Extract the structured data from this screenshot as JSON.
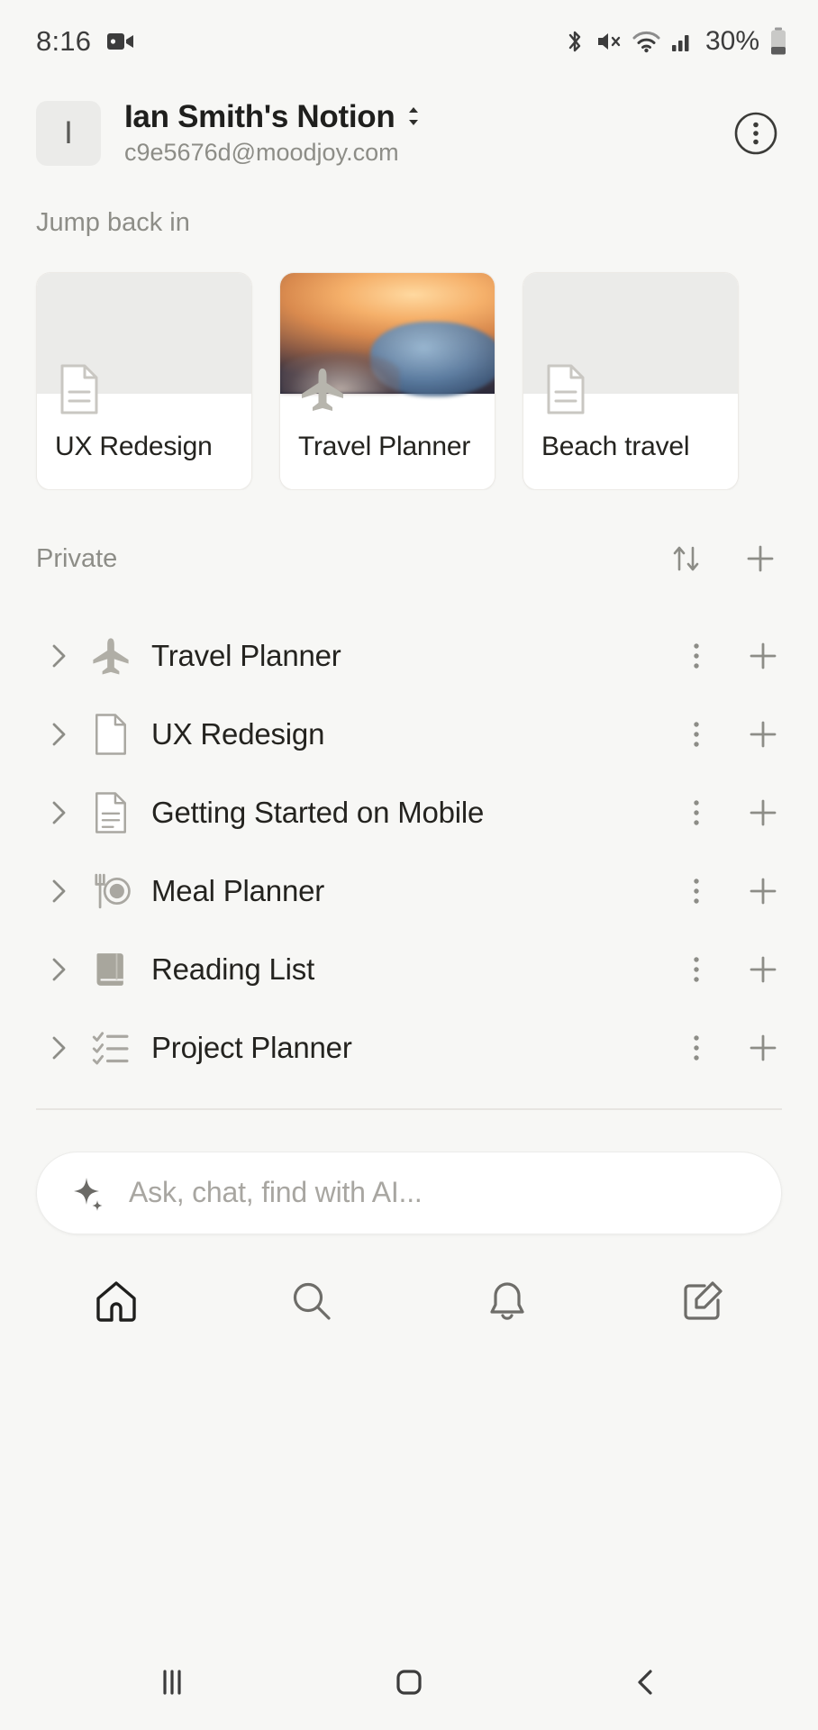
{
  "status_bar": {
    "time": "8:16",
    "battery_percent": "30%",
    "icons": [
      "video-record-icon",
      "bluetooth-icon",
      "mute-icon",
      "wifi-icon",
      "cellular-signal-icon",
      "battery-icon"
    ]
  },
  "workspace": {
    "avatar_letter": "I",
    "name": "Ian Smith's Notion",
    "email": "c9e5676d@moodjoy.com",
    "more_icon": "more-options-icon",
    "switch_icon": "chevron-up-down-icon"
  },
  "jump_back_in": {
    "title": "Jump back in",
    "cards": [
      {
        "title": "UX Redesign",
        "icon": "document-icon",
        "cover": "plain"
      },
      {
        "title": "Travel Planner",
        "icon": "airplane-icon",
        "cover": "sunset-photo"
      },
      {
        "title": "Beach travel",
        "icon": "document-icon",
        "cover": "plain"
      }
    ]
  },
  "private": {
    "title": "Private",
    "sort_icon": "sort-arrows-icon",
    "add_icon": "plus-icon",
    "items": [
      {
        "label": "Travel Planner",
        "icon": "airplane-icon"
      },
      {
        "label": "UX Redesign",
        "icon": "document-icon"
      },
      {
        "label": "Getting Started on Mobile",
        "icon": "lined-document-icon"
      },
      {
        "label": "Meal Planner",
        "icon": "fork-plate-icon"
      },
      {
        "label": "Reading List",
        "icon": "book-icon"
      },
      {
        "label": "Project Planner",
        "icon": "checklist-icon"
      }
    ],
    "row_menu_icon": "dots-vertical-icon",
    "row_add_icon": "plus-icon",
    "expand_icon": "chevron-right-icon"
  },
  "ai_bar": {
    "placeholder": "Ask, chat, find with AI...",
    "icon": "sparkle-icon"
  },
  "bottom_nav": {
    "items": [
      {
        "name": "home",
        "icon": "home-icon",
        "active": true
      },
      {
        "name": "search",
        "icon": "search-icon",
        "active": false
      },
      {
        "name": "inbox",
        "icon": "bell-icon",
        "active": false
      },
      {
        "name": "new-page",
        "icon": "compose-icon",
        "active": false
      }
    ]
  },
  "android_nav": {
    "recents_icon": "recents-icon",
    "home_icon": "home-square-icon",
    "back_icon": "back-chevron-icon"
  },
  "colors": {
    "background": "#f7f7f5",
    "card_background": "#ffffff",
    "text_primary": "#24231f",
    "text_secondary": "#8d8d87",
    "border": "#eceae6"
  }
}
